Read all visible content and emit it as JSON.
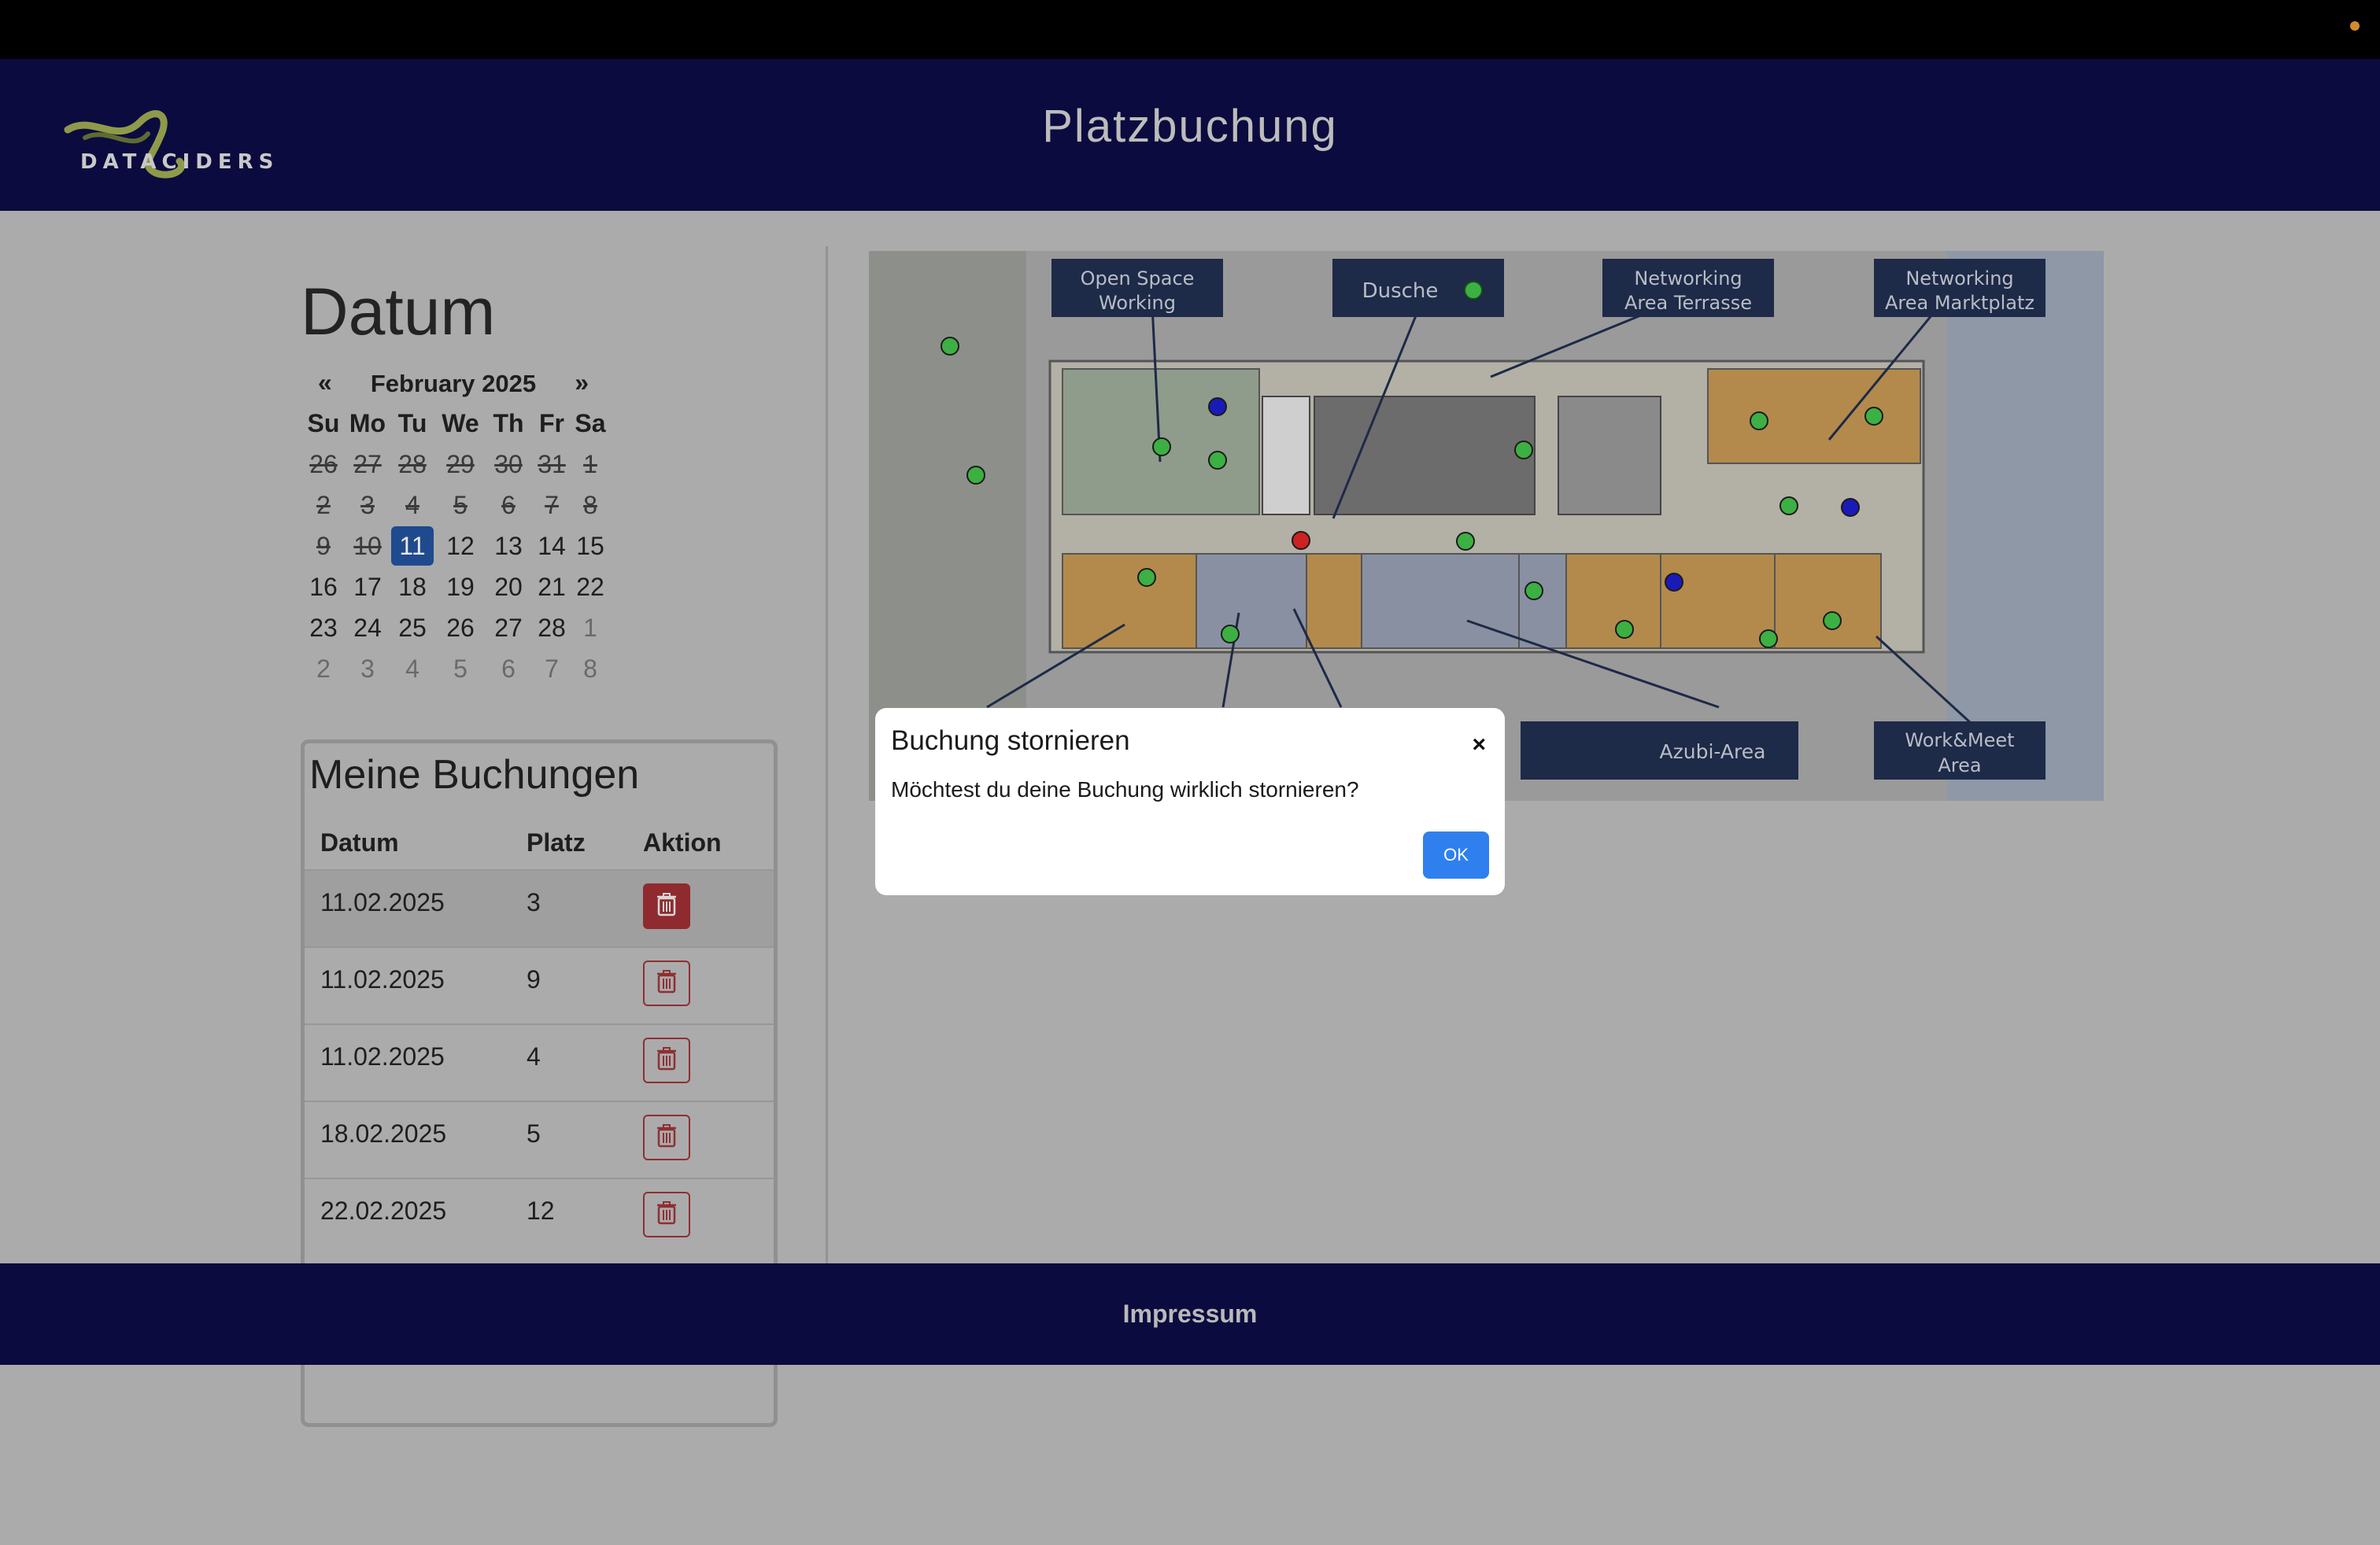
{
  "header": {
    "title": "Platzbuchung",
    "logo_text": "DATACIDERS"
  },
  "calendar": {
    "heading": "Datum",
    "prev": "«",
    "next": "»",
    "month": "February 2025",
    "weekdays": [
      "Su",
      "Mo",
      "Tu",
      "We",
      "Th",
      "Fr",
      "Sa"
    ],
    "weeks": [
      [
        "26",
        "27",
        "28",
        "29",
        "30",
        "31",
        "1"
      ],
      [
        "2",
        "3",
        "4",
        "5",
        "6",
        "7",
        "8"
      ],
      [
        "9",
        "10",
        "11",
        "12",
        "13",
        "14",
        "15"
      ],
      [
        "16",
        "17",
        "18",
        "19",
        "20",
        "21",
        "22"
      ],
      [
        "23",
        "24",
        "25",
        "26",
        "27",
        "28",
        "1"
      ],
      [
        "2",
        "3",
        "4",
        "5",
        "6",
        "7",
        "8"
      ]
    ],
    "selected_day": "11"
  },
  "bookings": {
    "title": "Meine Buchungen",
    "columns": [
      "Datum",
      "Platz",
      "Aktion"
    ],
    "rows": [
      {
        "date": "11.02.2025",
        "seat": "3"
      },
      {
        "date": "11.02.2025",
        "seat": "9"
      },
      {
        "date": "11.02.2025",
        "seat": "4"
      },
      {
        "date": "18.02.2025",
        "seat": "5"
      },
      {
        "date": "22.02.2025",
        "seat": "12"
      }
    ]
  },
  "map": {
    "labels": {
      "open_space_1": "Open Space",
      "open_space_2": "Working",
      "dusche": "Dusche",
      "terrasse_1": "Networking",
      "terrasse_2": "Area Terrasse",
      "markt_1": "Networking",
      "markt_2": "Area Marktplatz",
      "azubi": "Azubi-Area",
      "workmeet_1": "Work&Meet",
      "workmeet_2": "Area"
    },
    "colors": {
      "available": "#3cb043",
      "booked_mine": "#1a1ab8",
      "booked_other": "#cc2222"
    }
  },
  "modal": {
    "title": "Buchung stornieren",
    "close": "×",
    "message": "Möchtest du deine Buchung wirklich stornieren?",
    "ok": "OK"
  },
  "footer": {
    "link": "Impressum"
  }
}
